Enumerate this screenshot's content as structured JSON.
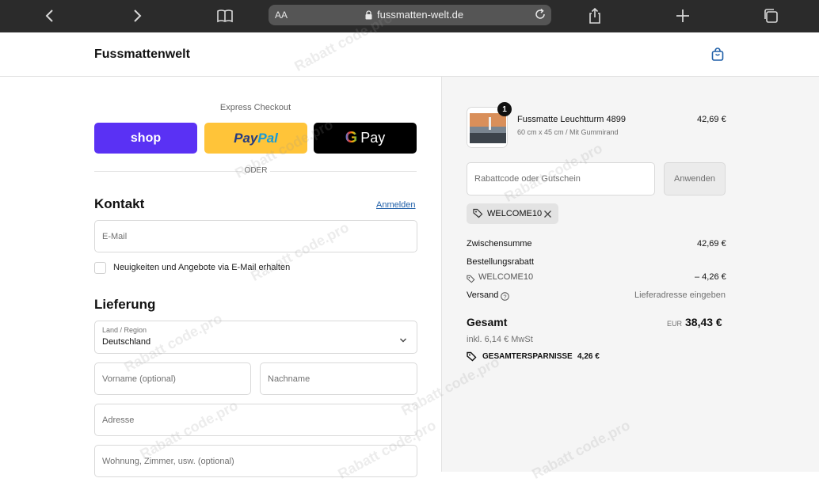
{
  "browser": {
    "text_size_label": "AA",
    "url": "fussmatten-welt.de"
  },
  "shop": {
    "brand": "Fussmattenwelt"
  },
  "express": {
    "label": "Express Checkout",
    "shop_label": "shop",
    "paypal_label": "PayPal",
    "gpay_label": "Pay",
    "divider": "ODER"
  },
  "contact": {
    "heading": "Kontakt",
    "login_link": "Anmelden",
    "email_placeholder": "E-Mail",
    "newsletter_label": "Neuigkeiten und Angebote via E-Mail erhalten"
  },
  "delivery": {
    "heading": "Lieferung",
    "country_label": "Land / Region",
    "country_value": "Deutschland",
    "firstname_placeholder": "Vorname (optional)",
    "lastname_placeholder": "Nachname",
    "address_placeholder": "Adresse",
    "apartment_placeholder": "Wohnung, Zimmer, usw. (optional)"
  },
  "summary": {
    "item": {
      "quantity": "1",
      "name": "Fussmatte Leuchtturm 4899",
      "variant": "60 cm x 45 cm / Mit Gummirand",
      "price": "42,69 €"
    },
    "coupon_placeholder": "Rabattcode oder Gutschein",
    "apply_label": "Anwenden",
    "applied_code": "WELCOME10",
    "subtotal_label": "Zwischensumme",
    "subtotal_value": "42,69 €",
    "discount_label": "Bestellungsrabatt",
    "discount_code": "WELCOME10",
    "discount_value": "– 4,26 €",
    "shipping_label": "Versand",
    "shipping_value": "Lieferadresse eingeben",
    "total_label": "Gesamt",
    "currency": "EUR",
    "total_value": "38,43 €",
    "tax_note": "inkl. 6,14 € MwSt",
    "savings_label": "GESAMTERSPARNISSE",
    "savings_value": "4,26 €"
  },
  "watermark": "Rabatt code.pro",
  "colors": {
    "shop_pay": "#5a31f4",
    "paypal": "#ffc439",
    "link": "#1f5fa8"
  }
}
